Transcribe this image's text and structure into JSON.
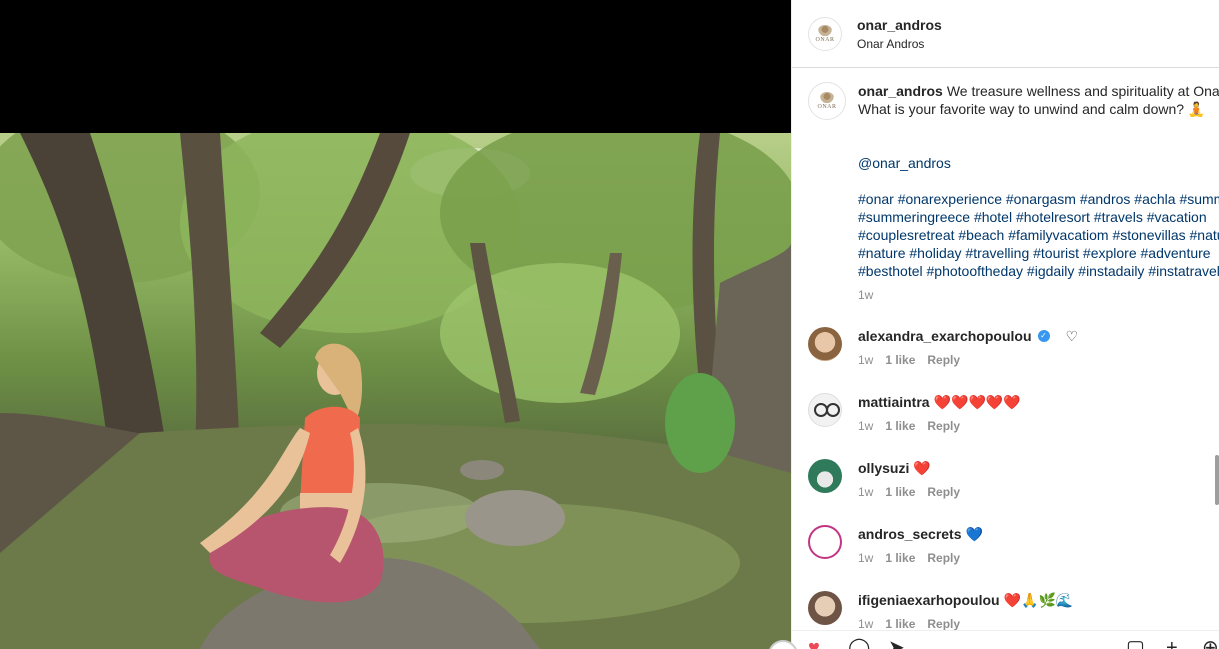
{
  "post": {
    "username": "onar_andros",
    "fullname": "Onar Andros",
    "logo_text": "ONAR",
    "caption_text": "We treasure wellness and spirituality at Onar. What is your favorite way to unwind and calm down? 🧘",
    "mention": "@onar_andros",
    "hashtags": [
      "#onar #onarexperience #onargasm #andros #achla #summer",
      "#summeringreece #hotel #hotelresort #travels #vacation",
      "#couplesretreat #beach #familyvacatiom #stonevillas #nature",
      "#nature #holiday #travelling #tourist #explore #adventure",
      "#besthotel #photooftheday #igdaily #instadaily #instatravel"
    ],
    "time": "1w"
  },
  "comments": [
    {
      "username": "alexandra_exarchopoulou",
      "text": "",
      "verified": true,
      "time": "1w",
      "likes": "1 like",
      "reply": "Reply"
    },
    {
      "username": "mattiaintra",
      "text": "❤️❤️❤️❤️❤️",
      "time": "1w",
      "likes": "1 like",
      "reply": "Reply"
    },
    {
      "username": "ollysuzi",
      "text": "❤️",
      "time": "1w",
      "likes": "1 like",
      "reply": "Reply"
    },
    {
      "username": "andros_secrets",
      "text": "💙",
      "time": "1w",
      "likes": "1 like",
      "reply": "Reply"
    },
    {
      "username": "ifigeniaexarhopoulou",
      "text": "❤️🙏🌿🌊",
      "time": "1w",
      "likes": "1 like",
      "reply": "Reply"
    }
  ],
  "icons": {
    "like": "heart-icon",
    "comment": "comment-icon",
    "share": "share-icon",
    "save": "bookmark-icon"
  },
  "colors": {
    "link": "#00376b",
    "muted": "#8e8e8e",
    "verified": "#3897f0"
  }
}
